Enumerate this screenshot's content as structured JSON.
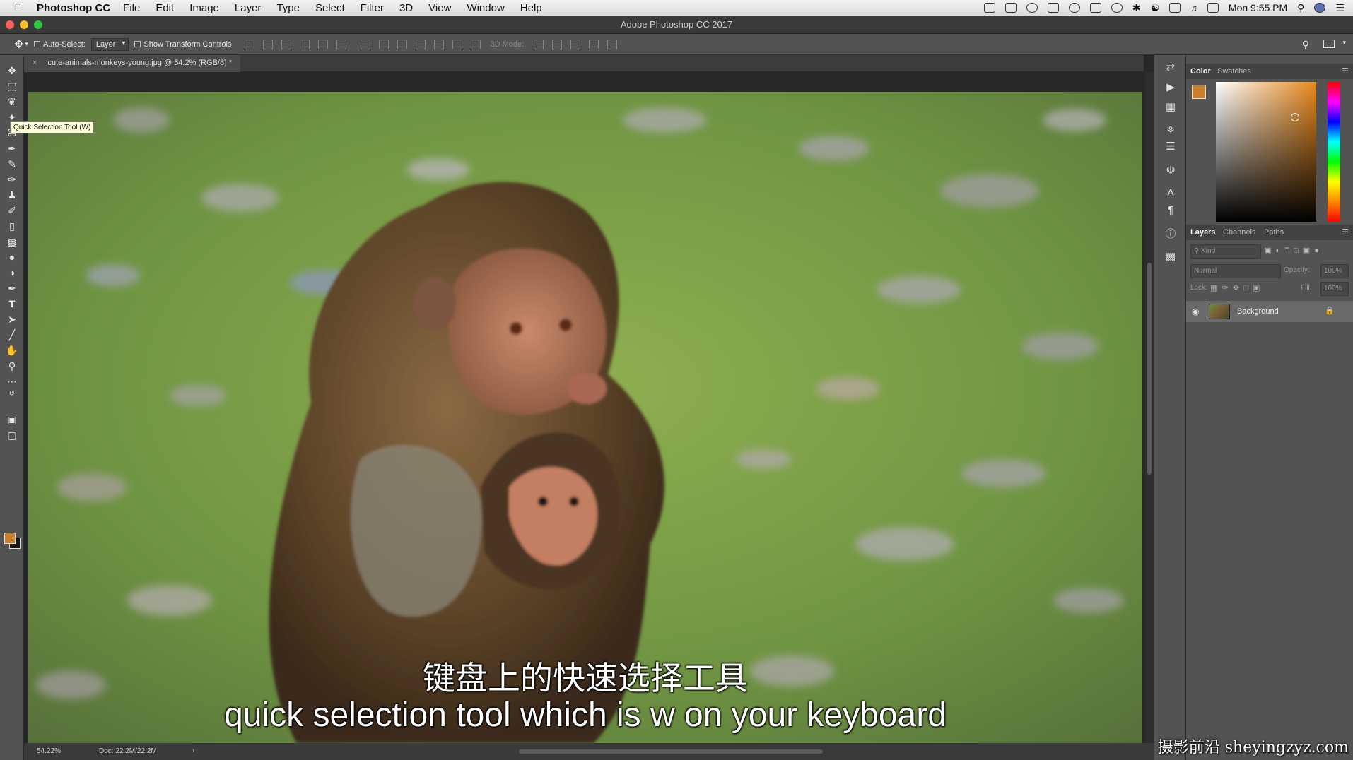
{
  "menubar": {
    "app_name": "Photoshop CC",
    "items": [
      "File",
      "Edit",
      "Image",
      "Layer",
      "Type",
      "Select",
      "Filter",
      "3D",
      "View",
      "Window",
      "Help"
    ],
    "clock": "Mon 9:55 PM"
  },
  "window": {
    "title": "Adobe Photoshop CC 2017"
  },
  "options_bar": {
    "auto_select_label": "Auto-Select:",
    "auto_select_value": "Layer",
    "show_transform_label": "Show Transform Controls",
    "mode_3d_label": "3D Mode:"
  },
  "document": {
    "tab_label": "cute-animals-monkeys-young.jpg @ 54.2% (RGB/8) *"
  },
  "tooltip": {
    "text": "Quick Selection Tool (W)"
  },
  "status": {
    "zoom": "54.22%",
    "doc_size": "Doc: 22.2M/22.2M"
  },
  "panels": {
    "color_tabs": [
      "Color",
      "Swatches"
    ],
    "layers_tabs": [
      "Layers",
      "Channels",
      "Paths"
    ],
    "kind_placeholder": "Kind",
    "blend_mode": "Normal",
    "opacity_label": "Opacity:",
    "opacity_value": "100%",
    "lock_label": "Lock:",
    "fill_label": "Fill:",
    "fill_value": "100%",
    "layer_name": "Background"
  },
  "colors": {
    "foreground": "#c8802a",
    "background": "#1a1a1a",
    "accent": "#e8891c"
  },
  "subtitles": {
    "chinese": "键盘上的快速选择工具",
    "english": "quick selection tool which is w on your keyboard"
  },
  "watermark": "摄影前沿 sheyingzyz.com"
}
